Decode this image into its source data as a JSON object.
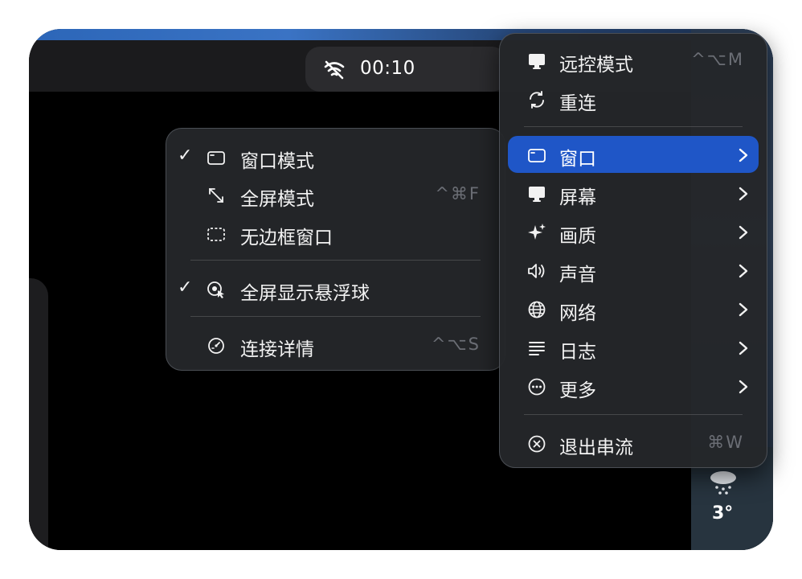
{
  "status": {
    "time": "00:10"
  },
  "weather": {
    "temperature": "3°"
  },
  "main_menu": {
    "items": [
      {
        "label": "远控模式",
        "shortcut": "^⌥M"
      },
      {
        "label": "重连"
      },
      {
        "label": "窗口"
      },
      {
        "label": "屏幕"
      },
      {
        "label": "画质"
      },
      {
        "label": "声音"
      },
      {
        "label": "网络"
      },
      {
        "label": "日志"
      },
      {
        "label": "更多"
      },
      {
        "label": "退出串流",
        "shortcut": "⌘W"
      }
    ],
    "selected_index": 2
  },
  "window_submenu": {
    "items": [
      {
        "label": "窗口模式",
        "checked": true
      },
      {
        "label": "全屏模式",
        "shortcut": "^⌘F"
      },
      {
        "label": "无边框窗口"
      },
      {
        "label": "全屏显示悬浮球",
        "checked": true
      },
      {
        "label": "连接详情",
        "shortcut": "^⌥S"
      }
    ]
  },
  "colors": {
    "selection": "#1f56c7",
    "menu_bg": "#24262a"
  }
}
